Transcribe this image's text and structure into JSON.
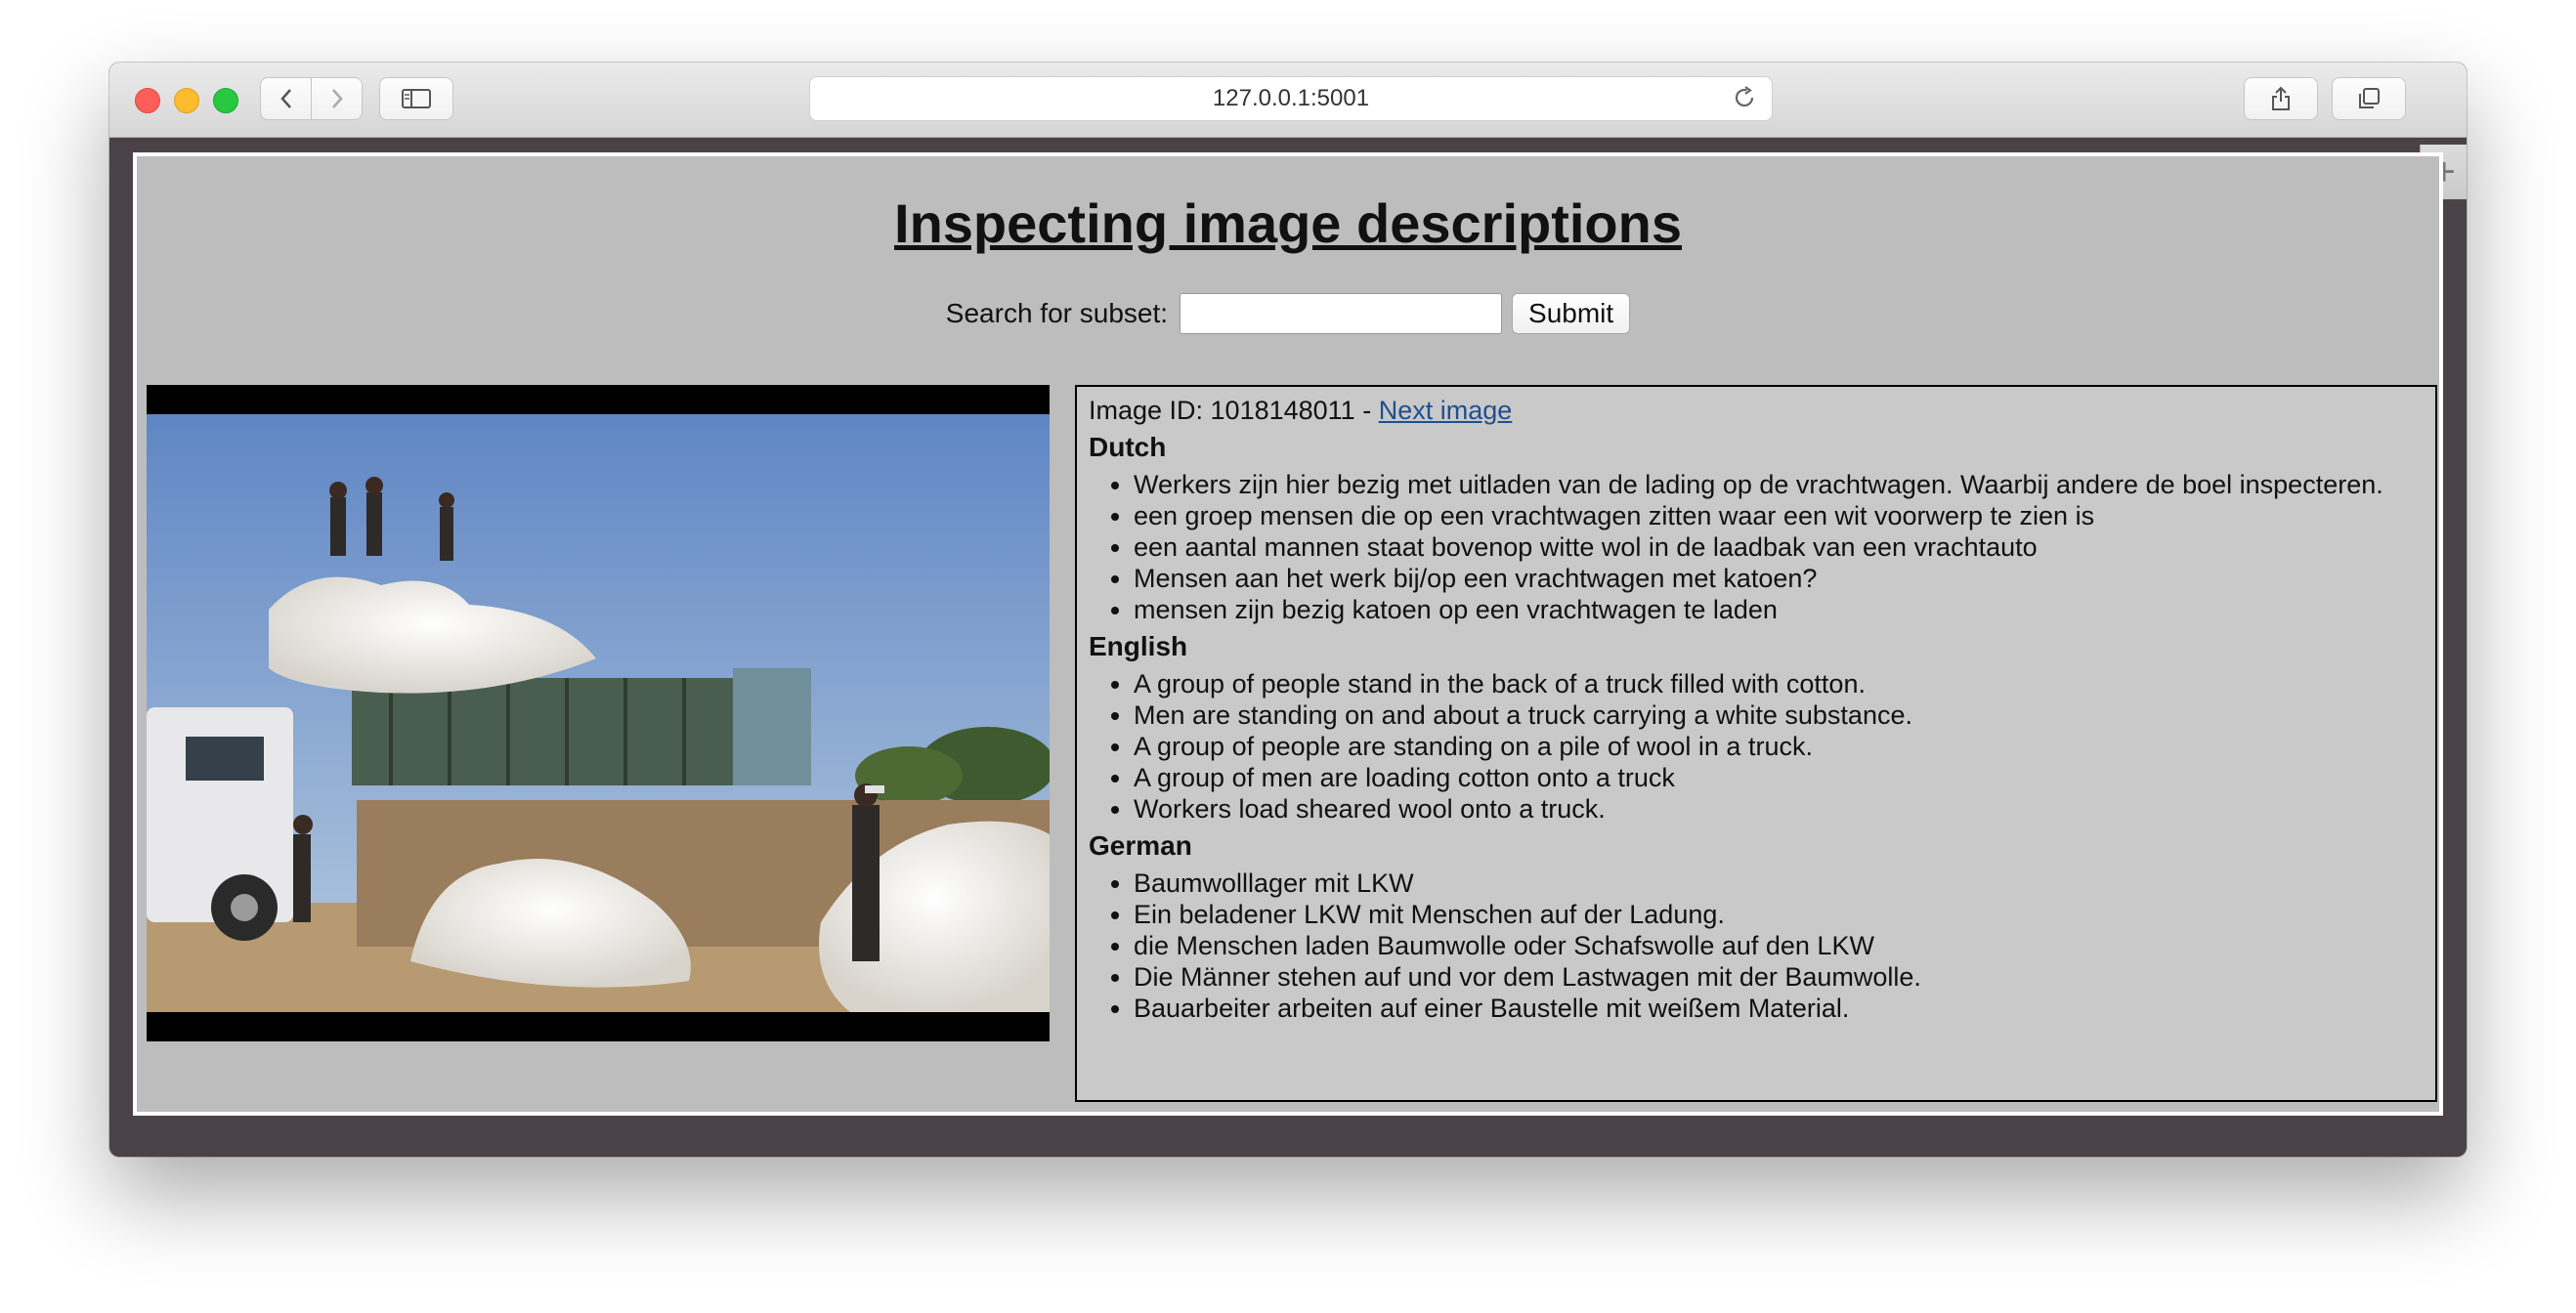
{
  "browser": {
    "url": "127.0.0.1:5001"
  },
  "page": {
    "title": "Inspecting image descriptions",
    "search_label": "Search for subset:",
    "search_value": "",
    "submit_label": "Submit"
  },
  "image": {
    "id_prefix": "Image ID: 1018148011 -",
    "next_link": "Next image"
  },
  "descriptions": [
    {
      "language": "Dutch",
      "items": [
        "Werkers zijn hier bezig met uitladen van de lading op de vrachtwagen. Waarbij andere de boel inspecteren.",
        "een groep mensen die op een vrachtwagen zitten waar een wit voorwerp te zien is",
        "een aantal mannen staat bovenop witte wol in de laadbak van een vrachtauto",
        "Mensen aan het werk bij/op een vrachtwagen met katoen?",
        "mensen zijn bezig katoen op een vrachtwagen te laden"
      ]
    },
    {
      "language": "English",
      "items": [
        "A group of people stand in the back of a truck filled with cotton.",
        "Men are standing on and about a truck carrying a white substance.",
        "A group of people are standing on a pile of wool in a truck.",
        "A group of men are loading cotton onto a truck",
        "Workers load sheared wool onto a truck."
      ]
    },
    {
      "language": "German",
      "items": [
        "Baumwolllager mit LKW",
        "Ein beladener LKW mit Menschen auf der Ladung.",
        "die Menschen laden Baumwolle oder Schafswolle auf den LKW",
        "Die Männer stehen auf und vor dem Lastwagen mit der Baumwolle.",
        "Bauarbeiter arbeiten auf einer Baustelle mit weißem Material."
      ]
    }
  ]
}
